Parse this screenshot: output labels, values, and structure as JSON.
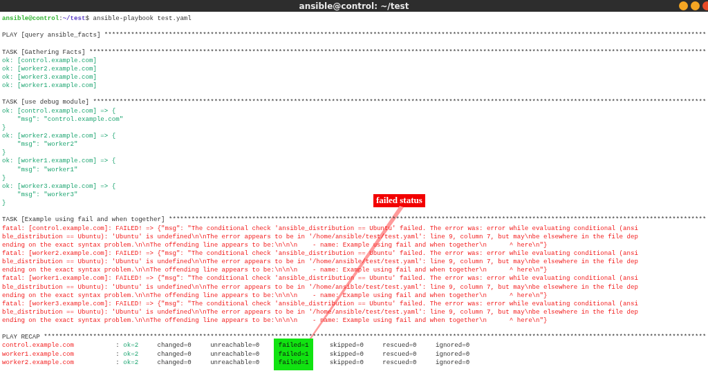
{
  "window": {
    "title": "ansible@control: ~/test"
  },
  "prompt": {
    "user_host": "ansible@control",
    "separator": ":",
    "path": "~/test",
    "command": "$ ansible-playbook test.yaml"
  },
  "lines": [
    {
      "kind": "blank"
    },
    {
      "kind": "header",
      "text": "PLAY [query ansible_facts] ***************************************************************************************************************************************************************"
    },
    {
      "kind": "blank"
    },
    {
      "kind": "header",
      "text": "TASK [Gathering Facts] *******************************************************************************************************************************************************************"
    },
    {
      "kind": "ok",
      "text": "ok: [control.example.com]"
    },
    {
      "kind": "ok",
      "text": "ok: [worker2.example.com]"
    },
    {
      "kind": "ok",
      "text": "ok: [worker3.example.com]"
    },
    {
      "kind": "ok",
      "text": "ok: [worker1.example.com]"
    },
    {
      "kind": "blank"
    },
    {
      "kind": "header",
      "text": "TASK [use debug module] ******************************************************************************************************************************************************************"
    },
    {
      "kind": "ok",
      "text": "ok: [control.example.com] => {"
    },
    {
      "kind": "ok",
      "text": "    \"msg\": \"control.example.com\""
    },
    {
      "kind": "ok",
      "text": "}"
    },
    {
      "kind": "ok",
      "text": "ok: [worker2.example.com] => {"
    },
    {
      "kind": "ok",
      "text": "    \"msg\": \"worker2\""
    },
    {
      "kind": "ok",
      "text": "}"
    },
    {
      "kind": "ok",
      "text": "ok: [worker1.example.com] => {"
    },
    {
      "kind": "ok",
      "text": "    \"msg\": \"worker1\""
    },
    {
      "kind": "ok",
      "text": "}"
    },
    {
      "kind": "ok",
      "text": "ok: [worker3.example.com] => {"
    },
    {
      "kind": "ok",
      "text": "    \"msg\": \"worker3\""
    },
    {
      "kind": "ok",
      "text": "}"
    },
    {
      "kind": "blank"
    },
    {
      "kind": "header",
      "text": "TASK [Example using fail and when together] **********************************************************************************************************************************************"
    },
    {
      "kind": "fatal",
      "text": "fatal: [control.example.com]: FAILED! => {\"msg\": \"The conditional check 'ansible_distribution == Ubuntu' failed. The error was: error while evaluating conditional (ansi"
    },
    {
      "kind": "fatal",
      "text": "ble_distribution == Ubuntu): 'Ubuntu' is undefined\\n\\nThe error appears to be in '/home/ansible/test/test.yaml': line 9, column 7, but may\\nbe elsewhere in the file dep"
    },
    {
      "kind": "fatal",
      "text": "ending on the exact syntax problem.\\n\\nThe offending line appears to be:\\n\\n\\n    - name: Example using fail and when together\\n      ^ here\\n\"}"
    },
    {
      "kind": "fatal",
      "text": "fatal: [worker2.example.com]: FAILED! => {\"msg\": \"The conditional check 'ansible_distribution == Ubuntu' failed. The error was: error while evaluating conditional (ansi"
    },
    {
      "kind": "fatal",
      "text": "ble_distribution == Ubuntu): 'Ubuntu' is undefined\\n\\nThe error appears to be in '/home/ansible/test/test.yaml': line 9, column 7, but may\\nbe elsewhere in the file dep"
    },
    {
      "kind": "fatal",
      "text": "ending on the exact syntax problem.\\n\\nThe offending line appears to be:\\n\\n\\n    - name: Example using fail and when together\\n      ^ here\\n\"}"
    },
    {
      "kind": "fatal",
      "text": "fatal: [worker1.example.com]: FAILED! => {\"msg\": \"The conditional check 'ansible_distribution == Ubuntu' failed. The error was: error while evaluating conditional (ansi"
    },
    {
      "kind": "fatal",
      "text": "ble_distribution == Ubuntu): 'Ubuntu' is undefined\\n\\nThe error appears to be in '/home/ansible/test/test.yaml': line 9, column 7, but may\\nbe elsewhere in the file dep"
    },
    {
      "kind": "fatal",
      "text": "ending on the exact syntax problem.\\n\\nThe offending line appears to be:\\n\\n\\n    - name: Example using fail and when together\\n      ^ here\\n\"}"
    },
    {
      "kind": "fatal",
      "text": "fatal: [worker3.example.com]: FAILED! => {\"msg\": \"The conditional check 'ansible_distribution == Ubuntu' failed. The error was: error while evaluating conditional (ansi"
    },
    {
      "kind": "fatal",
      "text": "ble_distribution == Ubuntu): 'Ubuntu' is undefined\\n\\nThe error appears to be in '/home/ansible/test/test.yaml': line 9, column 7, but may\\nbe elsewhere in the file dep"
    },
    {
      "kind": "fatal",
      "text": "ending on the exact syntax problem.\\n\\nThe offending line appears to be:\\n\\n\\n    - name: Example using fail and when together\\n      ^ here\\n\"}"
    },
    {
      "kind": "blank"
    },
    {
      "kind": "header",
      "text": "PLAY RECAP *******************************************************************************************************************************************************************************"
    }
  ],
  "recap": [
    {
      "host": "control.example.com",
      "colon": ":",
      "ok": "ok=2",
      "changed": "changed=0",
      "unreachable": "unreachable=0",
      "failed": "failed=1",
      "skipped": "skipped=0",
      "rescued": "rescued=0",
      "ignored": "ignored=0"
    },
    {
      "host": "worker1.example.com",
      "colon": ":",
      "ok": "ok=2",
      "changed": "changed=0",
      "unreachable": "unreachable=0",
      "failed": "failed=1",
      "skipped": "skipped=0",
      "rescued": "rescued=0",
      "ignored": "ignored=0"
    },
    {
      "host": "worker2.example.com",
      "colon": ":",
      "ok": "ok=2",
      "changed": "changed=0",
      "unreachable": "unreachable=0",
      "failed": "failed=1",
      "skipped": "skipped=0",
      "rescued": "rescued=0",
      "ignored": "ignored=0"
    }
  ],
  "annotation": {
    "label": "failed status"
  }
}
